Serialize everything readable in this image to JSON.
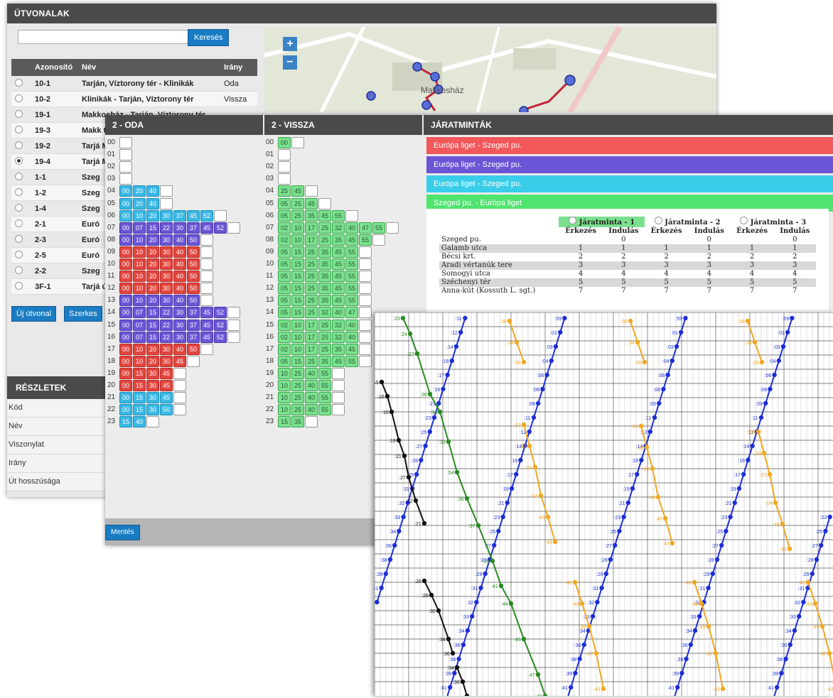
{
  "routes_panel": {
    "title": "ÚTVONALAK",
    "search_button": "Keresés",
    "columns": [
      "Azonosító",
      "Név",
      "Irány"
    ],
    "rows": [
      {
        "id": "10-1",
        "name": "Tarján, Víztorony tér - Klinikák",
        "dir": "Oda",
        "selected": false
      },
      {
        "id": "10-2",
        "name": "Klinikák - Tarján, Víztorony tér",
        "dir": "Vissza",
        "selected": false
      },
      {
        "id": "19-1",
        "name": "Makkosház - Tarján, Víztorony tér",
        "dir": "",
        "selected": false
      },
      {
        "id": "19-3",
        "name": "Makk tér",
        "dir": "",
        "selected": false
      },
      {
        "id": "19-2",
        "name": "Tarjá Makk",
        "dir": "",
        "selected": false
      },
      {
        "id": "19-4",
        "name": "Tarjá Makk",
        "dir": "",
        "selected": true
      },
      {
        "id": "1-1",
        "name": "Szeg",
        "dir": "",
        "selected": false
      },
      {
        "id": "1-2",
        "name": "Szeg",
        "dir": "",
        "selected": false
      },
      {
        "id": "1-4",
        "name": "Szeg",
        "dir": "",
        "selected": false
      },
      {
        "id": "2-1",
        "name": "Euró",
        "dir": "",
        "selected": false
      },
      {
        "id": "2-3",
        "name": "Euró",
        "dir": "",
        "selected": false
      },
      {
        "id": "2-5",
        "name": "Euró",
        "dir": "",
        "selected": false
      },
      {
        "id": "2-2",
        "name": "Szeg",
        "dir": "",
        "selected": false
      },
      {
        "id": "3F-1",
        "name": "Tarjá út",
        "dir": "",
        "selected": false
      }
    ],
    "new_route_button": "Új útvonal",
    "edit_button": "Szerkes",
    "map_zoom_in": "+",
    "map_zoom_out": "−",
    "map_place": "Makkosház",
    "details": {
      "title": "RÉSZLETEK",
      "fields": [
        "Kód",
        "Név",
        "Viszonylat",
        "Irány",
        "Út hosszúsága"
      ]
    }
  },
  "timetable": {
    "oda_title": "2 - ODA",
    "vissza_title": "2 - VISSZA",
    "save_button": "Mentés",
    "oda": [
      {
        "h": "00",
        "c": "",
        "m": []
      },
      {
        "h": "01",
        "c": "",
        "m": []
      },
      {
        "h": "02",
        "c": "",
        "m": []
      },
      {
        "h": "03",
        "c": "",
        "m": []
      },
      {
        "h": "04",
        "c": "b",
        "m": [
          "00",
          "20",
          "40"
        ]
      },
      {
        "h": "05",
        "c": "b",
        "m": [
          "00",
          "20",
          "40"
        ]
      },
      {
        "h": "06",
        "c": "b",
        "m": [
          "00",
          "10",
          "20",
          "30",
          "37",
          "45",
          "52"
        ]
      },
      {
        "h": "07",
        "c": "p",
        "m": [
          "00",
          "07",
          "15",
          "22",
          "30",
          "37",
          "45",
          "52"
        ]
      },
      {
        "h": "08",
        "c": "p",
        "m": [
          "00",
          "10",
          "20",
          "30",
          "40",
          "50"
        ]
      },
      {
        "h": "09",
        "c": "r",
        "m": [
          "00",
          "10",
          "20",
          "30",
          "40",
          "50"
        ]
      },
      {
        "h": "10",
        "c": "r",
        "m": [
          "00",
          "10",
          "20",
          "30",
          "40",
          "50"
        ]
      },
      {
        "h": "11",
        "c": "r",
        "m": [
          "00",
          "10",
          "20",
          "30",
          "40",
          "50"
        ]
      },
      {
        "h": "12",
        "c": "r",
        "m": [
          "00",
          "10",
          "20",
          "30",
          "40",
          "50"
        ]
      },
      {
        "h": "13",
        "c": "p",
        "m": [
          "00",
          "10",
          "20",
          "30",
          "40",
          "50"
        ]
      },
      {
        "h": "14",
        "c": "p",
        "m": [
          "00",
          "07",
          "15",
          "22",
          "30",
          "37",
          "45",
          "52"
        ]
      },
      {
        "h": "15",
        "c": "p",
        "m": [
          "00",
          "07",
          "15",
          "22",
          "30",
          "37",
          "45",
          "52"
        ]
      },
      {
        "h": "16",
        "c": "p",
        "m": [
          "00",
          "07",
          "15",
          "22",
          "30",
          "37",
          "45",
          "52"
        ]
      },
      {
        "h": "17",
        "c": "r",
        "m": [
          "00",
          "10",
          "20",
          "30",
          "40",
          "50"
        ]
      },
      {
        "h": "18",
        "c": "r",
        "m": [
          "00",
          "10",
          "20",
          "30",
          "45"
        ]
      },
      {
        "h": "19",
        "c": "r",
        "m": [
          "00",
          "15",
          "30",
          "45"
        ]
      },
      {
        "h": "20",
        "c": "r",
        "m": [
          "00",
          "15",
          "30",
          "45"
        ]
      },
      {
        "h": "21",
        "c": "b",
        "m": [
          "00",
          "15",
          "30",
          "45"
        ]
      },
      {
        "h": "22",
        "c": "b",
        "m": [
          "00",
          "15",
          "30",
          "50"
        ]
      },
      {
        "h": "23",
        "c": "b",
        "m": [
          "15",
          "40"
        ]
      }
    ],
    "vissza": [
      {
        "h": "00",
        "m": [
          "00"
        ]
      },
      {
        "h": "01",
        "m": []
      },
      {
        "h": "02",
        "m": []
      },
      {
        "h": "03",
        "m": []
      },
      {
        "h": "04",
        "m": [
          "25",
          "45"
        ]
      },
      {
        "h": "05",
        "m": [
          "05",
          "25",
          "45"
        ]
      },
      {
        "h": "06",
        "m": [
          "05",
          "25",
          "35",
          "45",
          "55"
        ]
      },
      {
        "h": "07",
        "m": [
          "02",
          "10",
          "17",
          "25",
          "32",
          "40",
          "47",
          "55"
        ]
      },
      {
        "h": "08",
        "m": [
          "02",
          "10",
          "17",
          "25",
          "35",
          "45",
          "55"
        ]
      },
      {
        "h": "09",
        "m": [
          "05",
          "15",
          "25",
          "35",
          "45",
          "55"
        ]
      },
      {
        "h": "10",
        "m": [
          "05",
          "15",
          "25",
          "35",
          "45",
          "55"
        ]
      },
      {
        "h": "11",
        "m": [
          "05",
          "15",
          "25",
          "35",
          "45",
          "55"
        ]
      },
      {
        "h": "12",
        "m": [
          "05",
          "15",
          "25",
          "35",
          "45",
          "55"
        ]
      },
      {
        "h": "13",
        "m": [
          "05",
          "15",
          "25",
          "35",
          "45",
          "55"
        ]
      },
      {
        "h": "14",
        "m": [
          "05",
          "15",
          "25",
          "32",
          "40",
          "47"
        ]
      },
      {
        "h": "15",
        "m": [
          "02",
          "10",
          "17",
          "25",
          "32",
          "40"
        ]
      },
      {
        "h": "16",
        "m": [
          "02",
          "10",
          "17",
          "25",
          "32",
          "40"
        ]
      },
      {
        "h": "17",
        "m": [
          "02",
          "10",
          "17",
          "25",
          "35",
          "45"
        ]
      },
      {
        "h": "18",
        "m": [
          "05",
          "15",
          "25",
          "35",
          "45",
          "55"
        ]
      },
      {
        "h": "19",
        "m": [
          "10",
          "25",
          "40",
          "55"
        ]
      },
      {
        "h": "20",
        "m": [
          "10",
          "25",
          "40",
          "55"
        ]
      },
      {
        "h": "21",
        "m": [
          "10",
          "25",
          "40",
          "55"
        ]
      },
      {
        "h": "22",
        "m": [
          "10",
          "25",
          "40",
          "55"
        ]
      },
      {
        "h": "23",
        "m": [
          "15",
          "35"
        ]
      }
    ]
  },
  "patterns": {
    "title": "JÁRATMINTÁK",
    "bars": [
      {
        "label": "Európa liget - Szeged pu.",
        "color": "#f2575a"
      },
      {
        "label": "Európa liget - Szeged pu.",
        "color": "#6b55d6"
      },
      {
        "label": "Európa liget - Szeged pu.",
        "color": "#39cdea"
      },
      {
        "label": "Szeged pu. - Európa liget",
        "color": "#4fe46e"
      }
    ],
    "table_headers": [
      "Járatminta - 1",
      "Járatminta - 2",
      "Járatminta - 3"
    ],
    "sub_headers": [
      "Érkezés",
      "Indulás",
      "Érkezés",
      "Indulás",
      "Érkezés",
      "Indulás"
    ],
    "stops": [
      {
        "name": "Szeged pu.",
        "vals": [
          "",
          "0",
          "",
          "0",
          "",
          "0"
        ]
      },
      {
        "name": "Galamb utca",
        "vals": [
          "1",
          "1",
          "1",
          "1",
          "1",
          "1"
        ]
      },
      {
        "name": "Bécsi krt.",
        "vals": [
          "2",
          "2",
          "2",
          "2",
          "2",
          "2"
        ]
      },
      {
        "name": "Aradi vértanúk tere",
        "vals": [
          "3",
          "3",
          "3",
          "3",
          "3",
          "3"
        ]
      },
      {
        "name": "Somogyi utca",
        "vals": [
          "4",
          "4",
          "4",
          "4",
          "4",
          "4"
        ]
      },
      {
        "name": "Széchenyi tér",
        "vals": [
          "5",
          "5",
          "5",
          "5",
          "5",
          "5"
        ]
      },
      {
        "name": "Anna-kút (Kossuth L. sgt.)",
        "vals": [
          "7",
          "7",
          "7",
          "7",
          "7",
          "7"
        ]
      }
    ]
  },
  "graph_labels": {
    "blue": [
      ":42",
      ":41",
      ":39",
      ":38",
      ":36",
      ":34",
      ":33",
      ":32",
      ":31",
      ":29",
      ":28",
      ":27",
      ":25",
      ":23",
      ":21",
      ":19",
      ":17",
      ":16",
      ":14",
      ":12",
      ":11",
      ":09",
      ":08",
      ":06",
      ":04",
      ":03",
      ":01",
      ":59",
      ":58",
      ":57",
      ":55",
      ":53",
      ":51",
      ":49",
      ":47",
      ":46",
      ":44",
      ":42",
      ":40",
      ":10"
    ],
    "green": [
      ":23",
      ":24",
      ":27",
      ":36",
      ":34",
      ":33",
      ":54",
      ":36",
      ":37",
      ":39",
      ":41",
      ":44",
      ":46",
      ":47",
      ":48",
      ":52",
      ":54"
    ],
    "black": [
      ":15",
      ":16",
      ":18",
      ":19",
      ":21",
      ":27",
      ":32",
      ":21",
      ":26",
      ":28",
      ":30",
      ":34",
      ":36"
    ],
    "orange": [
      ":38",
      ":34",
      ":36",
      ":03",
      ":33",
      ":01",
      ":04",
      ":40",
      ":43",
      ":46",
      ":48",
      ":49",
      ":47",
      ":43",
      ":40",
      ":42",
      ":40",
      ":44"
    ]
  },
  "colors": {
    "header": "#4a4a4a",
    "button": "#1a7cc2",
    "route_line": "#c0263a",
    "graph_blue": "#1d2ed8",
    "graph_green": "#2a8a22",
    "graph_orange": "#f0a820",
    "graph_black": "#111111"
  }
}
